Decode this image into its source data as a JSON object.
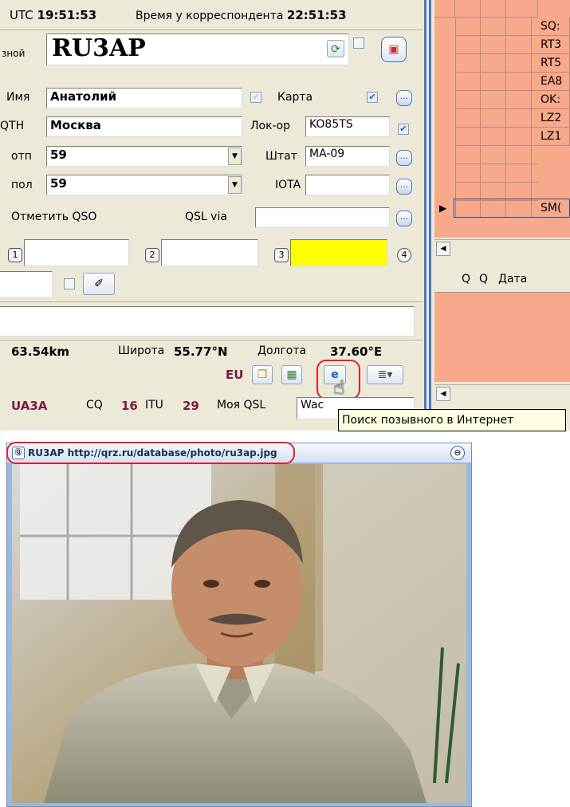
{
  "header": {
    "utc_label": "UTC",
    "utc_time": "19:51:53",
    "corr_label": "Время у корреспондента",
    "corr_time": "22:51:53"
  },
  "callsign": {
    "label": "зной",
    "value": "RU3AP"
  },
  "fields": {
    "name_label": "Имя",
    "name_value": "Анатолий",
    "qth_label": "QTH",
    "qth_value": "Москва",
    "sent_label": "отп",
    "sent_value": "59",
    "rcvd_label": "пол",
    "rcvd_value": "59",
    "map_label": "Карта",
    "locator_label": "Лок-ор",
    "locator_value": "KO85TS",
    "state_label": "Штат",
    "state_value": "MA-09",
    "iota_label": "IOTA",
    "iota_value": "",
    "mark_qso_label": "Отметить QSO",
    "qsl_via_label": "QSL via",
    "qsl_via_value": ""
  },
  "numbered_buttons": [
    "1",
    "2",
    "3",
    "4"
  ],
  "geo": {
    "distance": "63.54km",
    "lat_label": "Широта",
    "lat_value": "55.77°N",
    "lon_label": "Долгота",
    "lon_value": "37.60°E",
    "continent": "EU"
  },
  "bottom_row": {
    "prefix": "UA3A",
    "cq_label": "CQ",
    "cq_value": "16",
    "itu_label": "ITU",
    "itu_value": "29",
    "my_qsl_label": "Моя QSL",
    "my_qsl_value": "Waс"
  },
  "tooltip": "Поиск позывного в Интернет",
  "grid": {
    "rows": [
      "SQ:",
      "RT3",
      "RT5",
      "EA8",
      "OK:",
      "LZ2",
      "LZ1",
      "SM("
    ],
    "headers": [
      "Q",
      "Q",
      "Дата"
    ]
  },
  "photo_window": {
    "title": "RU3AP http://qrz.ru/database/photo/ru3ap.jpg"
  },
  "colors": {
    "panel": "#ECE9D8",
    "grid_fill": "#F8A98B",
    "highlight_red": "#E0202A",
    "yellow_field": "#FFFF00"
  }
}
